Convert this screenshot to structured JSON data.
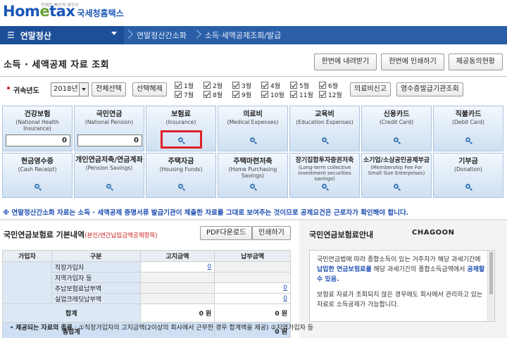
{
  "logo": {
    "brand_pre": "Hom",
    "brand_e": "e",
    "brand_post": "tax",
    "sub": "국세청홈택스",
    "tag": "언제든 빠르게 세무서"
  },
  "nav": {
    "menu": "연말정산",
    "crumb1": "연말정산간소화",
    "crumb2": "소득·세액공제조회/발급"
  },
  "page_title": "소득 · 세액공제 자료 조회",
  "top_buttons": {
    "download": "한번에 내려받기",
    "print": "한번에 인쇄하기",
    "consent": "제공동의현황"
  },
  "filter": {
    "label": "귀속년도",
    "year": "2018년",
    "select_all": "전체선택",
    "deselect_all": "선택해제",
    "months": [
      "1월",
      "2월",
      "3월",
      "4월",
      "5월",
      "6월",
      "7월",
      "8월",
      "9월",
      "10월",
      "11월",
      "12월"
    ],
    "medical_report": "의료비신고",
    "receipt_issuer": "영수증발급기관조회"
  },
  "tiles": [
    {
      "name": "건강보험",
      "en": "(National Health Insurance)",
      "value": "0"
    },
    {
      "name": "국민연금",
      "en": "(National Pension)",
      "value": "0"
    },
    {
      "name": "보험료",
      "en": "(Insurance)"
    },
    {
      "name": "의료비",
      "en": "(Medical Expenses)"
    },
    {
      "name": "교육비",
      "en": "(Education Expenses)"
    },
    {
      "name": "신용카드",
      "en": "(Credit Card)"
    },
    {
      "name": "직불카드",
      "en": "(Debit Card)"
    },
    {
      "name": "현금영수증",
      "en": "(Cash Receipt)"
    },
    {
      "name": "개인연금저축/연금계좌",
      "en": "(Pension Savings)"
    },
    {
      "name": "주택자금",
      "en": "(Housing Funds)"
    },
    {
      "name": "주택마련저축",
      "en": "(Home Purchasing Savings)"
    },
    {
      "name": "장기집합투자증권저축",
      "en": "(Long-term collective investment securities savings)"
    },
    {
      "name": "소기업/소상공인공제부금",
      "en": "(Membership Fee For Small Size Enterprises)"
    },
    {
      "name": "기부금",
      "en": "(Donation)"
    }
  ],
  "notice": "※ 연말정산간소화 자료는 소득 · 세액공제 증명서류 발급기관이 제출한 자료를 그대로 보여주는 것이므로 공제요건은 근로자가 확인해야 합니다.",
  "left_panel": {
    "title": "국민연금보험료 기본내역",
    "title_note": "(본인/연간납입금액공제항목)",
    "pdf_button": "PDF다운로드",
    "print_button": "인쇄하기",
    "headers": [
      "가입자",
      "구분",
      "고지금액",
      "납부금액"
    ],
    "rows": [
      {
        "type": "직장가입자",
        "notice": "0",
        "paid": ""
      },
      {
        "type": "지역가입자 등",
        "notice": "",
        "paid": ""
      },
      {
        "type": "추납보험료납부액",
        "notice": "",
        "paid": "0"
      },
      {
        "type": "실업크레딧납부액",
        "notice": "",
        "paid": "0"
      }
    ],
    "sum_label": "합계",
    "sum_notice": "0 원",
    "sum_paid": "0 원",
    "total_label": "총합계",
    "total_paid": "0 원"
  },
  "right_panel": {
    "title": "국민연금보험료안내",
    "brand": "CHAGOON",
    "p1a": "국민연금법에 따라 종합소득이 있는 거주자가 해당 과세기간에 ",
    "p1b": "납입한 연금보험료를",
    "p1c": " 해당 과세기간의 종합소득금액에서 ",
    "p1d": "공제할 수 있음.",
    "p2": "보험료 자료가 조회되지 않은 경우에도 회사에서 관리하고 있는 자료로 소득공제가 가능합니다.",
    "foot_label": "제공되는 자료의 종류",
    "foot_text": " : ①직장가입자의 고지금액(2이상의 회사에서 근무한 경우 합계액을 제공) ②지역가입자 등"
  }
}
